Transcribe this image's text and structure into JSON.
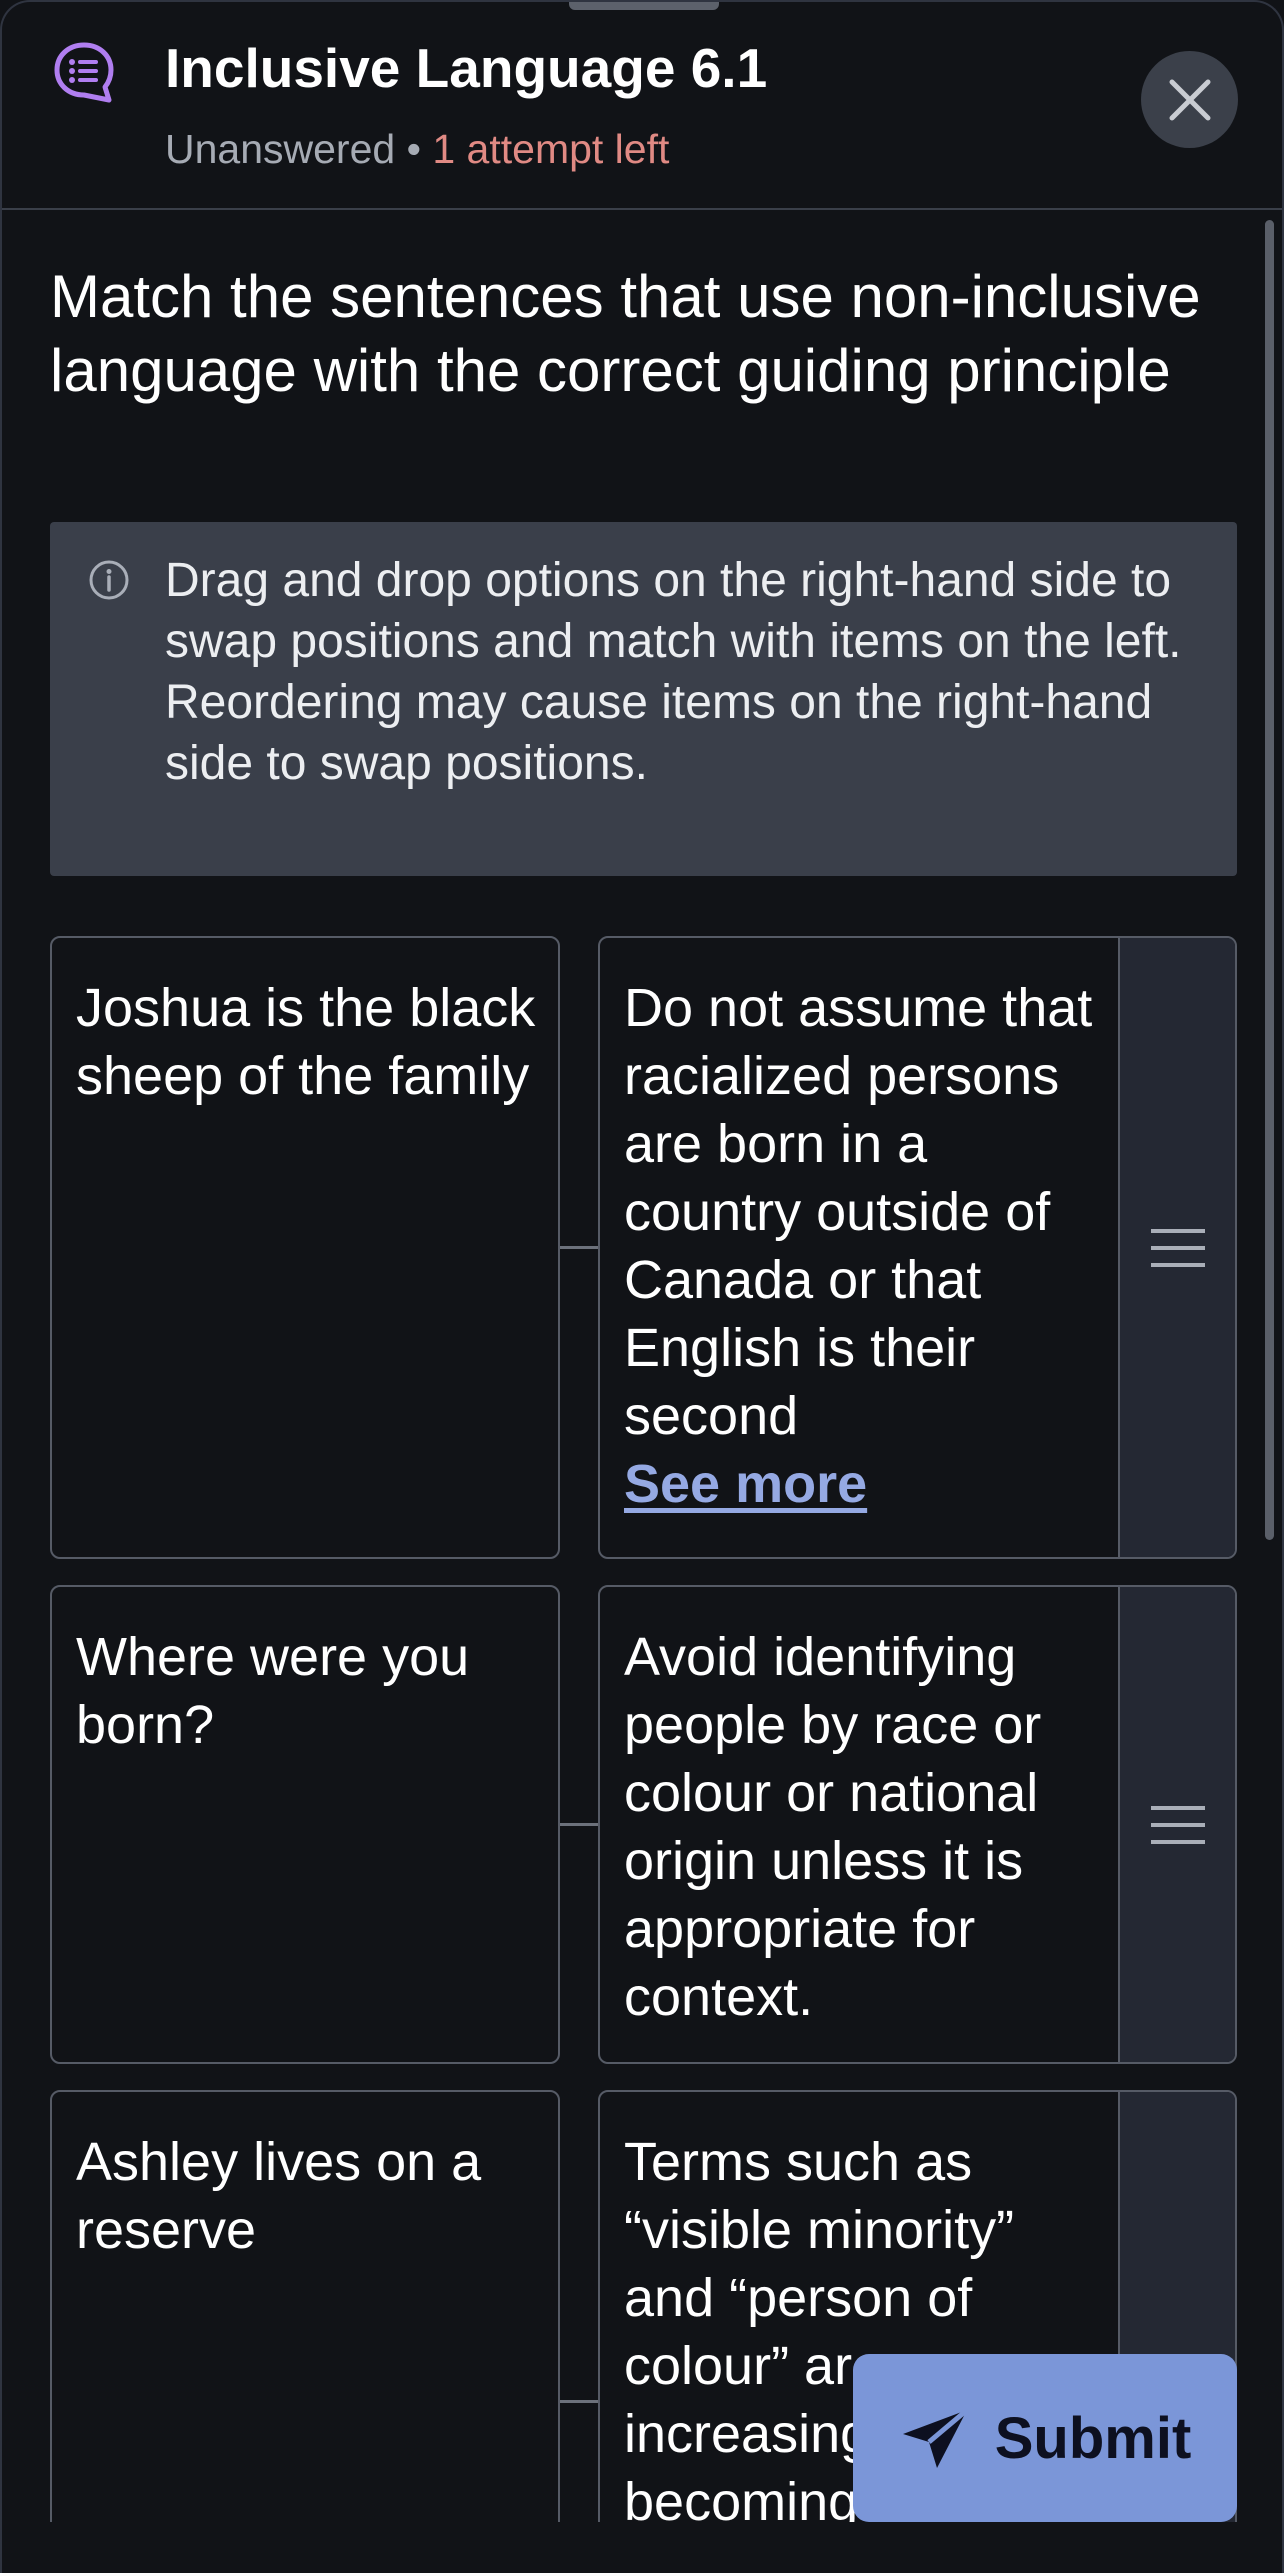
{
  "header": {
    "app_icon": "chat-list-icon",
    "title": "Inclusive Language 6.1",
    "status": "Unanswered",
    "separator": "•",
    "attempts": "1 attempt left",
    "close_icon": "close-icon"
  },
  "question": "Match the sentences that use non-inclusive language with the correct guiding principle",
  "info": {
    "icon": "info-icon",
    "line1": "Drag and drop options on the right-hand side to swap positions and match with items on the left.",
    "line2": "Reordering may cause items on the right-hand side to swap positions."
  },
  "matches": [
    {
      "prompt": "Joshua is the black sheep of the family",
      "answer": "Do not assume that racialized persons are born in a country outside of Canada or that English is their  second",
      "see_more": "See more",
      "handle_icon": "drag-handle-icon"
    },
    {
      "prompt": "Where were you born?",
      "answer": "Avoid identifying people by race or colour or national origin unless it is appropriate for context.",
      "handle_icon": "drag-handle-icon"
    },
    {
      "prompt": "Ashley lives on a reserve",
      "answer": "Terms such as “visible minority” and “person of colour” are increasingly becoming",
      "handle_icon": "drag-handle-icon"
    }
  ],
  "submit": {
    "icon": "send-icon",
    "label": "Submit"
  },
  "colors": {
    "background": "#111317",
    "accent": "#7b96d8",
    "link": "#95a9e3",
    "warning_text": "#e08a84",
    "app_icon": "#b07ef0"
  }
}
